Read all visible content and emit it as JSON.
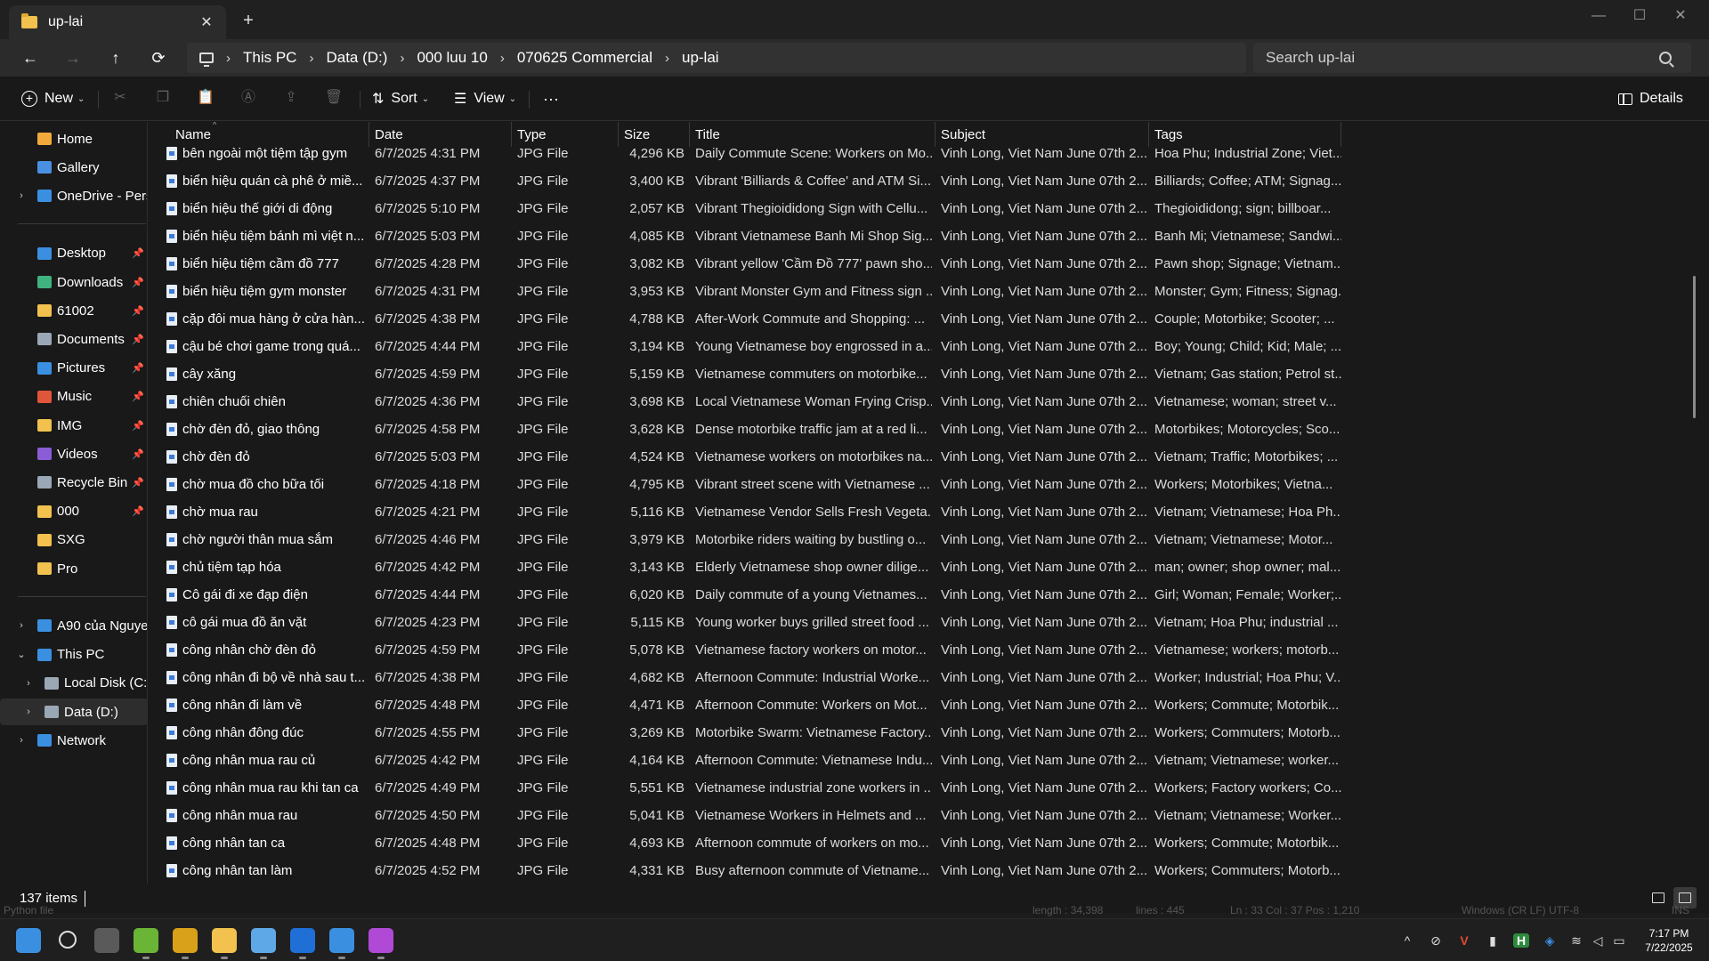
{
  "tab": {
    "title": "up-lai",
    "close": "✕",
    "new": "+"
  },
  "window_controls": {
    "minimize": "—",
    "maximize": "☐",
    "close": "✕"
  },
  "nav": {
    "back": "←",
    "forward": "→",
    "up": "↑",
    "refresh": "⟳"
  },
  "breadcrumb": [
    "This PC",
    "Data (D:)",
    "000 luu 10",
    "070625 Commercial",
    "up-lai"
  ],
  "breadcrumb_sep": "›",
  "search": {
    "placeholder": "Search up-lai"
  },
  "commandbar": {
    "new": "New",
    "sort": "Sort",
    "view": "View",
    "more": "···",
    "details": "Details",
    "caret": "⌄",
    "icons": {
      "cut": "✂",
      "copy": "❐",
      "paste": "📋",
      "rename": "Ⓐ",
      "share": "⇪",
      "delete": "🗑",
      "sort": "⇅",
      "view": "☰"
    }
  },
  "sidebar": {
    "chevron_collapsed": "›",
    "chevron_expanded": "⌄",
    "pin": "📌",
    "items": [
      {
        "label": "Home",
        "icon": "home-icon",
        "color": "#f2a93b",
        "y": 0
      },
      {
        "label": "Gallery",
        "icon": "gallery-icon",
        "color": "#4a90e2",
        "y": 1
      },
      {
        "label": "OneDrive - Pers",
        "icon": "cloud-icon",
        "color": "#3b8fe0",
        "y": 2,
        "chevron": true
      },
      {
        "label": "Desktop",
        "icon": "desktop-icon",
        "color": "#3b8fe0",
        "y": 4,
        "pin": true
      },
      {
        "label": "Downloads",
        "icon": "download-icon",
        "color": "#3fb27f",
        "y": 5,
        "pin": true
      },
      {
        "label": "61002",
        "icon": "folder-icon",
        "color": "#f2c14e",
        "y": 6,
        "pin": true
      },
      {
        "label": "Documents",
        "icon": "document-icon",
        "color": "#9aa7b5",
        "y": 7,
        "pin": true
      },
      {
        "label": "Pictures",
        "icon": "pictures-icon",
        "color": "#3b8fe0",
        "y": 8,
        "pin": true
      },
      {
        "label": "Music",
        "icon": "music-icon",
        "color": "#e0563b",
        "y": 9,
        "pin": true
      },
      {
        "label": "IMG",
        "icon": "folder-icon",
        "color": "#f2c14e",
        "y": 10,
        "pin": true
      },
      {
        "label": "Videos",
        "icon": "videos-icon",
        "color": "#8a5cd6",
        "y": 11,
        "pin": true
      },
      {
        "label": "Recycle Bin",
        "icon": "recycle-bin-icon",
        "color": "#9aa7b5",
        "y": 12,
        "pin": true
      },
      {
        "label": "000",
        "icon": "folder-icon",
        "color": "#f2c14e",
        "y": 13,
        "pin": true
      },
      {
        "label": "SXG",
        "icon": "folder-icon",
        "color": "#f2c14e",
        "y": 14
      },
      {
        "label": "Pro",
        "icon": "folder-icon",
        "color": "#f2c14e",
        "y": 15
      },
      {
        "label": "A90 của Nguye",
        "icon": "phone-icon",
        "color": "#3b8fe0",
        "y": 17,
        "chevron": true
      },
      {
        "label": "This PC",
        "icon": "pc-icon",
        "color": "#3b8fe0",
        "y": 18,
        "expanded": true
      },
      {
        "label": "Local Disk (C:)",
        "icon": "drive-icon",
        "color": "#9aa7b5",
        "y": 19,
        "chevron": true,
        "indent": true
      },
      {
        "label": "Data (D:)",
        "icon": "drive-icon",
        "color": "#9aa7b5",
        "y": 20,
        "chevron": true,
        "indent": true,
        "selected": true
      },
      {
        "label": "Network",
        "icon": "network-icon",
        "color": "#3b8fe0",
        "y": 21,
        "chevron": true
      }
    ]
  },
  "columns": [
    "Name",
    "Date",
    "Type",
    "Size",
    "Title",
    "Subject",
    "Tags"
  ],
  "sort_indicator": "^",
  "files": [
    [
      "bên ngoài một tiệm tập gym",
      "6/7/2025 4:31 PM",
      "JPG File",
      "4,296 KB",
      "Daily Commute Scene: Workers on Mo...",
      "Vinh Long, Viet Nam June 07th 2...",
      "Hoa Phu; Industrial Zone; Viet..."
    ],
    [
      "biển hiệu quán cà phê ở miề...",
      "6/7/2025 4:37 PM",
      "JPG File",
      "3,400 KB",
      "Vibrant 'Billiards & Coffee' and ATM Si...",
      "Vinh Long, Viet Nam June 07th 2...",
      "Billiards; Coffee; ATM; Signag..."
    ],
    [
      "biển hiệu thế giới di động",
      "6/7/2025 5:10 PM",
      "JPG File",
      "2,057 KB",
      "Vibrant Thegioididong Sign with Cellu...",
      "Vinh Long, Viet Nam June 07th 2...",
      "Thegioididong; sign; billboar..."
    ],
    [
      "biển hiệu tiệm bánh mì việt n...",
      "6/7/2025 5:03 PM",
      "JPG File",
      "4,085 KB",
      "Vibrant Vietnamese Banh Mi Shop Sig...",
      "Vinh Long, Viet Nam June 07th 2...",
      "Banh Mi; Vietnamese; Sandwi..."
    ],
    [
      "biển hiệu tiệm cầm đồ 777",
      "6/7/2025 4:28 PM",
      "JPG File",
      "3,082 KB",
      "Vibrant yellow 'Cầm Đồ 777' pawn sho...",
      "Vinh Long, Viet Nam June 07th 2...",
      "Pawn shop; Signage; Vietnam..."
    ],
    [
      "biển hiệu tiệm gym monster",
      "6/7/2025 4:31 PM",
      "JPG File",
      "3,953 KB",
      "Vibrant Monster Gym and Fitness sign ...",
      "Vinh Long, Viet Nam June 07th 2...",
      "Monster; Gym; Fitness; Signag..."
    ],
    [
      "cặp đôi mua hàng ở cửa hàn...",
      "6/7/2025 4:38 PM",
      "JPG File",
      "4,788 KB",
      "After-Work Commute and Shopping: ...",
      "Vinh Long, Viet Nam June 07th 2...",
      "Couple; Motorbike; Scooter; ..."
    ],
    [
      "cậu bé chơi game trong quá...",
      "6/7/2025 4:44 PM",
      "JPG File",
      "3,194 KB",
      "Young Vietnamese boy engrossed in a...",
      "Vinh Long, Viet Nam June 07th 2...",
      "Boy; Young; Child; Kid; Male; ..."
    ],
    [
      "cây xăng",
      "6/7/2025 4:59 PM",
      "JPG File",
      "5,159 KB",
      "Vietnamese commuters on motorbike...",
      "Vinh Long, Viet Nam June 07th 2...",
      "Vietnam; Gas station; Petrol st..."
    ],
    [
      "chiên chuối chiên",
      "6/7/2025 4:36 PM",
      "JPG File",
      "3,698 KB",
      "Local Vietnamese Woman Frying Crisp...",
      "Vinh Long, Viet Nam June 07th 2...",
      "Vietnamese; woman; street v..."
    ],
    [
      "chờ đèn đỏ, giao thông",
      "6/7/2025 4:58 PM",
      "JPG File",
      "3,628 KB",
      "Dense motorbike traffic jam at a red li...",
      "Vinh Long, Viet Nam June 07th 2...",
      "Motorbikes; Motorcycles; Sco..."
    ],
    [
      "chờ đèn đỏ",
      "6/7/2025 5:03 PM",
      "JPG File",
      "4,524 KB",
      "Vietnamese workers on motorbikes na...",
      "Vinh Long, Viet Nam June 07th 2...",
      "Vietnam; Traffic; Motorbikes; ..."
    ],
    [
      "chờ mua đồ cho bữa tối",
      "6/7/2025 4:18 PM",
      "JPG File",
      "4,795 KB",
      "Vibrant street scene with Vietnamese ...",
      "Vinh Long, Viet Nam June 07th 2...",
      "Workers; Motorbikes; Vietna..."
    ],
    [
      "chờ mua rau",
      "6/7/2025 4:21 PM",
      "JPG File",
      "5,116 KB",
      "Vietnamese Vendor Sells Fresh Vegeta...",
      "Vinh Long, Viet Nam June 07th 2...",
      "Vietnam; Vietnamese; Hoa Ph..."
    ],
    [
      "chờ người thân mua sắm",
      "6/7/2025 4:46 PM",
      "JPG File",
      "3,979 KB",
      "Motorbike riders waiting by bustling o...",
      "Vinh Long, Viet Nam June 07th 2...",
      "Vietnam; Vietnamese; Motor..."
    ],
    [
      "chủ tiệm tạp hóa",
      "6/7/2025 4:42 PM",
      "JPG File",
      "3,143 KB",
      "Elderly Vietnamese shop owner dilige...",
      "Vinh Long, Viet Nam June 07th 2...",
      "man; owner; shop owner; mal..."
    ],
    [
      "Cô gái đi xe đạp điện",
      "6/7/2025 4:44 PM",
      "JPG File",
      "6,020 KB",
      "Daily commute of a young Vietnames...",
      "Vinh Long, Viet Nam June 07th 2...",
      "Girl; Woman; Female; Worker;..."
    ],
    [
      "cô gái mua đồ ăn vặt",
      "6/7/2025 4:23 PM",
      "JPG File",
      "5,115 KB",
      "Young worker buys grilled street food ...",
      "Vinh Long, Viet Nam June 07th 2...",
      "Vietnam; Hoa Phu; industrial ..."
    ],
    [
      "công nhân chờ đèn đỏ",
      "6/7/2025 4:59 PM",
      "JPG File",
      "5,078 KB",
      "Vietnamese factory workers on motor...",
      "Vinh Long, Viet Nam June 07th 2...",
      "Vietnamese; workers; motorb..."
    ],
    [
      "công nhân đi bộ về nhà sau t...",
      "6/7/2025 4:38 PM",
      "JPG File",
      "4,682 KB",
      "Afternoon Commute: Industrial Worke...",
      "Vinh Long, Viet Nam June 07th 2...",
      "Worker; Industrial; Hoa Phu; V..."
    ],
    [
      "công nhân đi làm về",
      "6/7/2025 4:48 PM",
      "JPG File",
      "4,471 KB",
      "Afternoon Commute: Workers on Mot...",
      "Vinh Long, Viet Nam June 07th 2...",
      "Workers; Commute; Motorbik..."
    ],
    [
      "công nhân đông đúc",
      "6/7/2025 4:55 PM",
      "JPG File",
      "3,269 KB",
      "Motorbike Swarm: Vietnamese Factory...",
      "Vinh Long, Viet Nam June 07th 2...",
      "Workers; Commuters; Motorb..."
    ],
    [
      "công nhân mua rau củ",
      "6/7/2025 4:42 PM",
      "JPG File",
      "4,164 KB",
      "Afternoon Commute: Vietnamese Indu...",
      "Vinh Long, Viet Nam June 07th 2...",
      "Vietnam; Vietnamese; worker..."
    ],
    [
      "công nhân mua rau khi tan ca",
      "6/7/2025 4:49 PM",
      "JPG File",
      "5,551 KB",
      "Vietnamese industrial zone workers in ...",
      "Vinh Long, Viet Nam June 07th 2...",
      "Workers; Factory workers; Co..."
    ],
    [
      "công nhân mua rau",
      "6/7/2025 4:50 PM",
      "JPG File",
      "5,041 KB",
      "Vietnamese Workers in Helmets and ...",
      "Vinh Long, Viet Nam June 07th 2...",
      "Vietnam; Vietnamese; Worker..."
    ],
    [
      "công nhân tan ca",
      "6/7/2025 4:48 PM",
      "JPG File",
      "4,693 KB",
      "Afternoon commute of workers on mo...",
      "Vinh Long, Viet Nam June 07th 2...",
      "Workers; Commute; Motorbik..."
    ],
    [
      "công nhân tan làm",
      "6/7/2025 4:52 PM",
      "JPG File",
      "4,331 KB",
      "Busy afternoon commute of Vietname...",
      "Vinh Long, Viet Nam June 07th 2...",
      "Workers; Commuters; Motorb..."
    ]
  ],
  "status": {
    "count": "137 items"
  },
  "behind_window": {
    "left": "Python file",
    "length": "length : 34,398",
    "lines": "lines : 445",
    "pos": "Ln : 33    Col : 37    Pos : 1,210",
    "enc": "Windows (CR LF)   UTF-8",
    "mode": "INS"
  },
  "taskbar": {
    "apps": [
      "start-icon",
      "search-icon",
      "task-view-icon",
      "notepad-plus-icon",
      "chrome-canary-icon",
      "file-explorer-icon",
      "notepad-icon",
      "photoshop-icon",
      "app-icon",
      "messenger-icon"
    ],
    "tray": {
      "chevron": "^",
      "v": "V",
      "h": "H"
    },
    "time": "7:17 PM",
    "date": "7/22/2025"
  }
}
